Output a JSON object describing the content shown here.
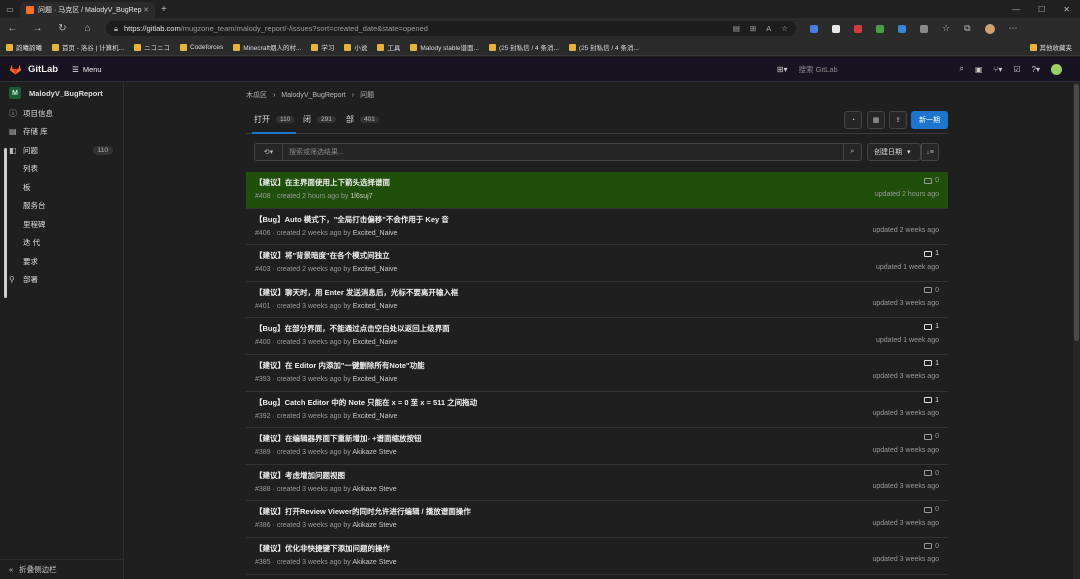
{
  "browser": {
    "tab_title": "问题 · 马克区 / MalodyV_BugRep",
    "url_host": "https://gitlab.com",
    "url_path": "/mugzone_team/malody_report/-/issues?sort=created_date&state=opened",
    "bookmarks": [
      "韵曦韵曦",
      "首页 - 洛谷 | 计算机...",
      "ニコニコ",
      "Codeforces",
      "Minecraft烟人的村...",
      "学习",
      "小说",
      "工具",
      "Malody stable谱面...",
      "(25 封私信 / 4 条消...",
      "(25 封私信 / 4 条消..."
    ],
    "bookmarks_right": "其他收藏夹"
  },
  "header": {
    "brand": "GitLab",
    "menu": "Menu",
    "search_placeholder": "搜索 GitLab"
  },
  "sidebar": {
    "project_initial": "M",
    "project_name": "MalodyV_BugReport",
    "items": [
      {
        "label": "项目信息",
        "icon": "info-icon"
      },
      {
        "label": "存储 库",
        "icon": "repo-icon"
      },
      {
        "label": "问题",
        "icon": "issues-icon",
        "badge": "110"
      },
      {
        "label": "列表",
        "sub": true
      },
      {
        "label": "板",
        "sub": true
      },
      {
        "label": "服务台",
        "sub": true
      },
      {
        "label": "里程碑",
        "sub": true
      },
      {
        "label": "迭 代",
        "sub": true
      },
      {
        "label": "要求",
        "sub": true
      },
      {
        "label": "部署",
        "icon": "deploy-icon"
      }
    ],
    "collapse_label": "折叠侧边栏"
  },
  "breadcrumb": {
    "group": "木瓜区",
    "project": "MalodyV_BugReport",
    "page": "问题"
  },
  "tabs": [
    {
      "label": "打开",
      "count": "110"
    },
    {
      "label": "闭",
      "count": "291"
    },
    {
      "label": "部",
      "count": "401"
    }
  ],
  "new_issue_label": "新一期",
  "filter": {
    "placeholder": "搜索或筛选结果...",
    "sort_label": "创建日期"
  },
  "issues": [
    {
      "title": "【建议】在主界面使用上下箭头选择谱面",
      "id": "#408",
      "created": "created 2 hours ago by",
      "author": "1l6suj7",
      "comments": "0",
      "updated": "updated 2 hours ago",
      "highlighted": true
    },
    {
      "title": "【Bug】Auto 模式下，\"全局打击偏移\"不会作用于 Key 音",
      "id": "#406",
      "created": "created 2 weeks ago by",
      "author": "Excited_Naive",
      "comments": "",
      "updated": "updated 2 weeks ago"
    },
    {
      "title": "【建议】将\"背景暗度\"在各个模式间独立",
      "id": "#403",
      "created": "created 2 weeks ago by",
      "author": "Excited_Naive",
      "comments": "1",
      "updated": "updated 1 week ago"
    },
    {
      "title": "【建议】聊天时，用 Enter 发送消息后，光标不要离开输入框",
      "id": "#401",
      "created": "created 3 weeks ago by",
      "author": "Excited_Naive",
      "comments": "0",
      "updated": "updated 3 weeks ago"
    },
    {
      "title": "【Bug】在部分界面，不能通过点击空白处以返回上级界面",
      "id": "#400",
      "created": "created 3 weeks ago by",
      "author": "Excited_Naive",
      "comments": "1",
      "updated": "updated 1 week ago"
    },
    {
      "title": "【建议】在 Editor 内添加\"一键删除所有Note\"功能",
      "id": "#393",
      "created": "created 3 weeks ago by",
      "author": "Excited_Naive",
      "comments": "1",
      "updated": "updated 3 weeks ago"
    },
    {
      "title": "【Bug】Catch Editor 中的 Note 只能在 x = 0 至 x = 511 之间拖动",
      "id": "#392",
      "created": "created 3 weeks ago by",
      "author": "Excited_Naive",
      "comments": "1",
      "updated": "updated 3 weeks ago"
    },
    {
      "title": "【建议】在编辑器界面下重新增加- +谱面缩放按钮",
      "id": "#389",
      "created": "created 3 weeks ago by",
      "author": "Akikaze Steve",
      "comments": "0",
      "updated": "updated 3 weeks ago"
    },
    {
      "title": "【建议】考虑增加问题视图",
      "id": "#388",
      "created": "created 3 weeks ago by",
      "author": "Akikaze Steve",
      "comments": "0",
      "updated": "updated 3 weeks ago"
    },
    {
      "title": "【建议】打开Review Viewer的同时允许进行编辑 / 播放谱面操作",
      "id": "#386",
      "created": "created 3 weeks ago by",
      "author": "Akikaze Steve",
      "comments": "0",
      "updated": "updated 3 weeks ago"
    },
    {
      "title": "【建议】优化非快捷键下添加问题的操作",
      "id": "#385",
      "created": "created 3 weeks ago by",
      "author": "Akikaze Steve",
      "comments": "0",
      "updated": "updated 3 weeks ago"
    }
  ],
  "colors": {
    "accent": "#1f75cb",
    "highlight_row": "#1f4f0a",
    "header_bg": "#171321"
  }
}
